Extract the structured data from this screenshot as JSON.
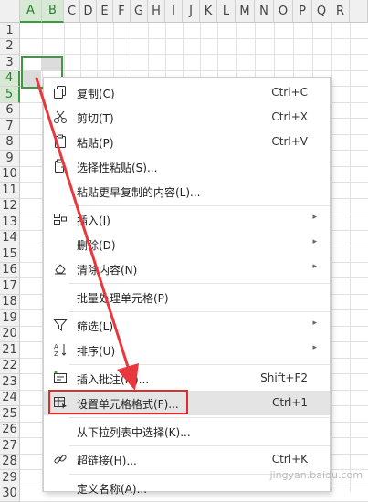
{
  "columns": [
    "A",
    "B",
    "C",
    "D",
    "E",
    "F",
    "G",
    "H",
    "I",
    "J",
    "K",
    "L",
    "M",
    "N",
    "O",
    "P",
    "Q",
    "R"
  ],
  "rows": [
    "1",
    "2",
    "3",
    "4",
    "5",
    "6",
    "7",
    "8",
    "9",
    "10",
    "11",
    "12",
    "13",
    "14",
    "15",
    "16",
    "17",
    "18",
    "19",
    "20",
    "21",
    "22",
    "23",
    "24",
    "25",
    "26",
    "27",
    "28",
    "29",
    "30"
  ],
  "menu": {
    "items": [
      {
        "label": "复制(C)",
        "shortcut": "Ctrl+C",
        "icon": "copy-icon"
      },
      {
        "label": "剪切(T)",
        "shortcut": "Ctrl+X",
        "icon": "scissors-icon"
      },
      {
        "label": "粘贴(P)",
        "shortcut": "Ctrl+V",
        "icon": "paste-icon"
      },
      {
        "label": "选择性粘贴(S)...",
        "shortcut": "",
        "icon": "paste-special-icon"
      },
      {
        "label": "粘贴更早复制的内容(L)...",
        "shortcut": "",
        "icon": ""
      },
      {
        "label": "插入(I)",
        "shortcut": "",
        "icon": "insert-icon",
        "submenu": true
      },
      {
        "label": "删除(D)",
        "shortcut": "",
        "icon": "",
        "submenu": true
      },
      {
        "label": "清除内容(N)",
        "shortcut": "",
        "icon": "eraser-icon",
        "submenu": true
      },
      {
        "label": "批量处理单元格(P)",
        "shortcut": "",
        "icon": ""
      },
      {
        "label": "筛选(L)",
        "shortcut": "",
        "icon": "filter-icon",
        "submenu": true
      },
      {
        "label": "排序(U)",
        "shortcut": "",
        "icon": "sort-icon",
        "submenu": true
      },
      {
        "label": "插入批注(M)...",
        "shortcut": "Shift+F2",
        "icon": "comment-icon"
      },
      {
        "label": "设置单元格格式(F)...",
        "shortcut": "Ctrl+1",
        "icon": "format-cells-icon"
      },
      {
        "label": "从下拉列表中选择(K)...",
        "shortcut": "",
        "icon": ""
      },
      {
        "label": "超链接(H)...",
        "shortcut": "Ctrl+K",
        "icon": "link-icon"
      },
      {
        "label": "定义名称(A)...",
        "shortcut": "",
        "icon": ""
      }
    ]
  },
  "watermark": "jingyan.baidu.com",
  "colors": {
    "selection": "#3c9b40",
    "highlight_box": "#e02b2b",
    "arrow": "#e8383d"
  }
}
